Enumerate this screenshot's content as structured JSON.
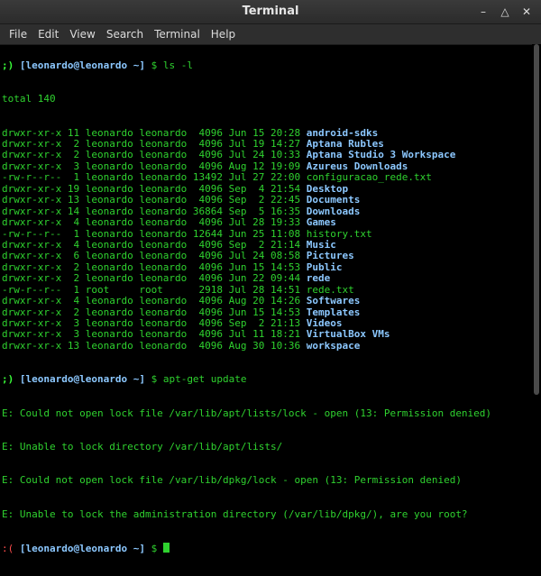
{
  "window": {
    "title": "Terminal"
  },
  "menu": [
    "File",
    "Edit",
    "View",
    "Search",
    "Terminal",
    "Help"
  ],
  "prompt": {
    "user": "[leonardo@leonardo ~]",
    "ok": ";)",
    "err": ":("
  },
  "cmd1": "$ ls -l",
  "total": "total 140",
  "listing": [
    {
      "meta": "drwxr-xr-x 11 leonardo leonardo  4096 Jun 15 20:28 ",
      "name": "android-sdks",
      "kind": "dir"
    },
    {
      "meta": "drwxr-xr-x  2 leonardo leonardo  4096 Jul 19 14:27 ",
      "name": "Aptana Rubles",
      "kind": "dir"
    },
    {
      "meta": "drwxr-xr-x  2 leonardo leonardo  4096 Jul 24 10:33 ",
      "name": "Aptana Studio 3 Workspace",
      "kind": "dir"
    },
    {
      "meta": "drwxr-xr-x  3 leonardo leonardo  4096 Aug 12 19:09 ",
      "name": "Azureus Downloads",
      "kind": "dir"
    },
    {
      "meta": "-rw-r--r--  1 leonardo leonardo 13492 Jul 27 22:00 ",
      "name": "configuracao_rede.txt",
      "kind": "file"
    },
    {
      "meta": "drwxr-xr-x 19 leonardo leonardo  4096 Sep  4 21:54 ",
      "name": "Desktop",
      "kind": "dir"
    },
    {
      "meta": "drwxr-xr-x 13 leonardo leonardo  4096 Sep  2 22:45 ",
      "name": "Documents",
      "kind": "dir"
    },
    {
      "meta": "drwxr-xr-x 14 leonardo leonardo 36864 Sep  5 16:35 ",
      "name": "Downloads",
      "kind": "dir"
    },
    {
      "meta": "drwxr-xr-x  4 leonardo leonardo  4096 Jul 28 19:33 ",
      "name": "Games",
      "kind": "dir"
    },
    {
      "meta": "-rw-r--r--  1 leonardo leonardo 12644 Jun 25 11:08 ",
      "name": "history.txt",
      "kind": "file"
    },
    {
      "meta": "drwxr-xr-x  4 leonardo leonardo  4096 Sep  2 21:14 ",
      "name": "Music",
      "kind": "dir"
    },
    {
      "meta": "drwxr-xr-x  6 leonardo leonardo  4096 Jul 24 08:58 ",
      "name": "Pictures",
      "kind": "dir"
    },
    {
      "meta": "drwxr-xr-x  2 leonardo leonardo  4096 Jun 15 14:53 ",
      "name": "Public",
      "kind": "dir"
    },
    {
      "meta": "drwxr-xr-x  2 leonardo leonardo  4096 Jun 22 09:44 ",
      "name": "rede",
      "kind": "dir"
    },
    {
      "meta": "-rw-r--r--  1 root     root      2918 Jul 28 14:51 ",
      "name": "rede.txt",
      "kind": "file"
    },
    {
      "meta": "drwxr-xr-x  4 leonardo leonardo  4096 Aug 20 14:26 ",
      "name": "Softwares",
      "kind": "dir"
    },
    {
      "meta": "drwxr-xr-x  2 leonardo leonardo  4096 Jun 15 14:53 ",
      "name": "Templates",
      "kind": "dir"
    },
    {
      "meta": "drwxr-xr-x  3 leonardo leonardo  4096 Sep  2 21:13 ",
      "name": "Videos",
      "kind": "dir"
    },
    {
      "meta": "drwxr-xr-x  3 leonardo leonardo  4096 Jul 11 18:21 ",
      "name": "VirtualBox VMs",
      "kind": "dir"
    },
    {
      "meta": "drwxr-xr-x 13 leonardo leonardo  4096 Aug 30 10:36 ",
      "name": "workspace",
      "kind": "dir"
    }
  ],
  "cmd2": "$ apt-get update",
  "errors": [
    "E: Could not open lock file /var/lib/apt/lists/lock - open (13: Permission denied)",
    "E: Unable to lock directory /var/lib/apt/lists/",
    "E: Could not open lock file /var/lib/dpkg/lock - open (13: Permission denied)",
    "E: Unable to lock the administration directory (/var/lib/dpkg/), are you root?"
  ],
  "final_prompt_symbol": "$"
}
